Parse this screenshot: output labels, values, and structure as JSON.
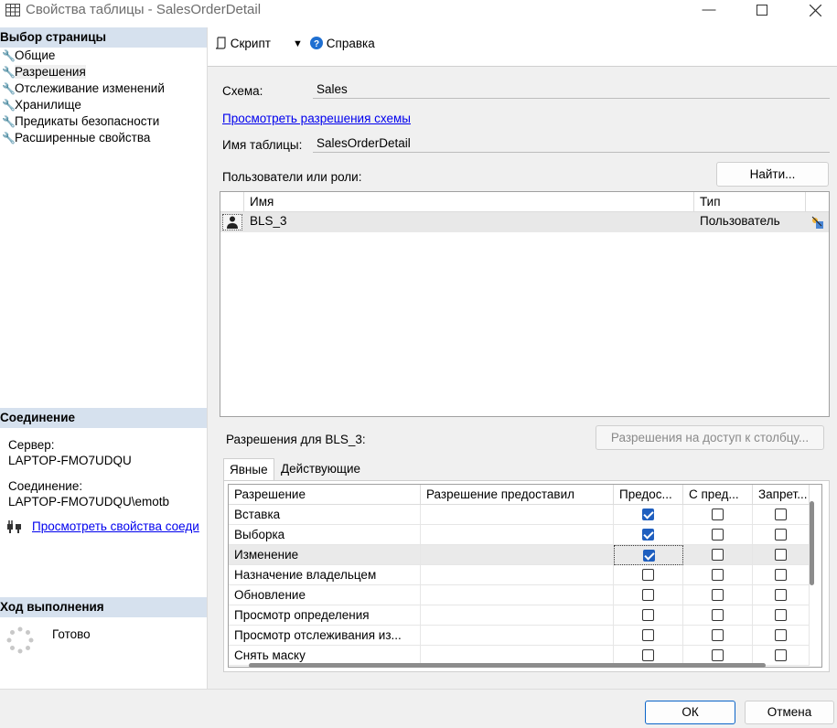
{
  "window": {
    "title": "Свойства таблицы - SalesOrderDetail"
  },
  "left": {
    "select_page_header": "Выбор страницы",
    "nav_items": [
      {
        "label": "Общие"
      },
      {
        "label": "Разрешения"
      },
      {
        "label": "Отслеживание изменений"
      },
      {
        "label": "Хранилище"
      },
      {
        "label": "Предикаты безопасности"
      },
      {
        "label": "Расширенные свойства"
      }
    ],
    "connection_header": "Соединение",
    "server_label": "Сервер:",
    "server_value": "LAPTOP-FMO7UDQU",
    "connection_label": "Соединение:",
    "connection_value": "LAPTOP-FMO7UDQU\\emotb",
    "view_conn_props_link": "Просмотреть свойства соеди",
    "progress_header": "Ход выполнения",
    "progress_status": "Готово"
  },
  "toolbar": {
    "script_label": "Скрипт",
    "help_label": "Справка"
  },
  "form": {
    "schema_label": "Схема:",
    "schema_value": "Sales",
    "view_schema_perms_link": "Просмотреть разрешения схемы",
    "table_name_label": "Имя таблицы:",
    "table_name_value": "SalesOrderDetail",
    "users_roles_label": "Пользователи или роли:",
    "find_button": "Найти...",
    "users_grid": {
      "columns": [
        "Имя",
        "Тип"
      ],
      "rows": [
        {
          "name": "BLS_3",
          "type": "Пользователь"
        }
      ]
    },
    "perms_for_label": "Разрешения для BLS_3:",
    "column_perms_button": "Разрешения на доступ к столбцу...",
    "tabs": [
      "Явные",
      "Действующие"
    ],
    "perm_grid": {
      "columns": [
        "Разрешение",
        "Разрешение предоставил",
        "Предос...",
        "С пред...",
        "Запрет..."
      ],
      "rows": [
        {
          "perm": "Вставка",
          "grantor": "",
          "grant": true,
          "with_grant": false,
          "deny": false
        },
        {
          "perm": "Выборка",
          "grantor": "",
          "grant": true,
          "with_grant": false,
          "deny": false
        },
        {
          "perm": "Изменение",
          "grantor": "",
          "grant": true,
          "with_grant": false,
          "deny": false
        },
        {
          "perm": "Назначение владельцем",
          "grantor": "",
          "grant": false,
          "with_grant": false,
          "deny": false
        },
        {
          "perm": "Обновление",
          "grantor": "",
          "grant": false,
          "with_grant": false,
          "deny": false
        },
        {
          "perm": "Просмотр определения",
          "grantor": "",
          "grant": false,
          "with_grant": false,
          "deny": false
        },
        {
          "perm": "Просмотр отслеживания из...",
          "grantor": "",
          "grant": false,
          "with_grant": false,
          "deny": false
        },
        {
          "perm": "Снять маску",
          "grantor": "",
          "grant": false,
          "with_grant": false,
          "deny": false
        }
      ]
    }
  },
  "footer": {
    "ok_label": "ОК",
    "cancel_label": "Отмена"
  },
  "colors": {
    "section_header_bg": "#d6e1ee",
    "checkbox_on": "#1f5fbf",
    "link": "#0000ee"
  }
}
